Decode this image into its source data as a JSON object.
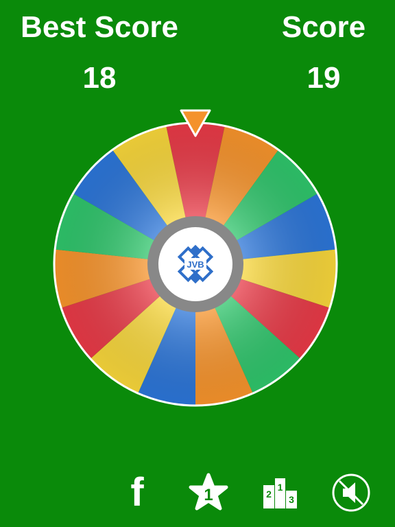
{
  "header": {
    "best_score_label": "Best Score",
    "best_score_value": "18",
    "score_label": "Score",
    "score_value": "19"
  },
  "wheel": {
    "logo_text": "JVB",
    "segment_colors": [
      "#e63946",
      "#f4922b",
      "#2ec36a",
      "#2b74d6",
      "#f5d43a",
      "#e63946",
      "#2ec36a",
      "#f4922b",
      "#2b74d6",
      "#f5d43a",
      "#e63946",
      "#f4922b",
      "#2ec36a",
      "#2b74d6",
      "#f5d43a"
    ],
    "pointer_color": "#f4922b"
  },
  "toolbar": {
    "facebook_icon": "facebook-icon",
    "facebook_glyph": "f",
    "rate_icon": "star-icon",
    "rate_glyph": "1",
    "leaderboard_icon": "leaderboard-podium-icon",
    "leaderboard_places": [
      "2",
      "1",
      "3"
    ],
    "sound_icon": "sound-muted-icon"
  },
  "colors": {
    "background": "#0a8a0a",
    "text": "#ffffff",
    "hub_ring": "#888888",
    "logo_blue": "#2f6fc9"
  }
}
